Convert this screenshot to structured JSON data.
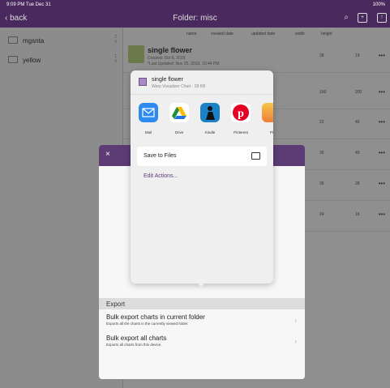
{
  "status": {
    "time": "9:09 PM  Tue Dec 31",
    "battery": "100%"
  },
  "nav": {
    "back_label": "back",
    "title": "Folder: misc",
    "icons": [
      "search-icon",
      "new-folder-icon",
      "export-icon"
    ]
  },
  "sidebar": {
    "folders": [
      {
        "name": "mgsnta",
        "count_a": "2",
        "count_b": "0"
      },
      {
        "name": "yellow",
        "count_a": "1",
        "count_b": "0"
      }
    ]
  },
  "columns": [
    "name",
    "created date",
    "updated date",
    "width",
    "height"
  ],
  "charts": [
    {
      "name": "single flower",
      "created": "Created: Oct 6, 2019",
      "updated": "*Last Updated: Nov 25, 2019, 10:44 PM",
      "width": "28",
      "height": "19"
    },
    {
      "width": "100",
      "height": "200"
    },
    {
      "width": "22",
      "height": "46"
    },
    {
      "width": "36",
      "height": "49"
    },
    {
      "width": "36",
      "height": "28"
    },
    {
      "width": "24",
      "height": "16"
    }
  ],
  "modal": {
    "close_label": "×",
    "section_label": "Export",
    "items": [
      {
        "title": "Bulk export charts in current folder",
        "desc": "Exports all the charts in the currently viewed folder."
      },
      {
        "title": "Bulk export all charts",
        "desc": "Exports all charts from this device."
      }
    ]
  },
  "share": {
    "file_name": "single flower",
    "file_meta": "Warp Visualizer Chart · 28 KB",
    "apps": [
      {
        "label": "Mail",
        "color": "#2d8bf0",
        "icon": "mail-icon"
      },
      {
        "label": "Drive",
        "color": "#ffffff",
        "icon": "drive-icon"
      },
      {
        "label": "Kindle",
        "color": "#1c82c6",
        "icon": "kindle-icon"
      },
      {
        "label": "Pinterest",
        "color": "#ffffff",
        "icon": "pinterest-icon"
      },
      {
        "label": "Pi",
        "color": "#f3a43b",
        "icon": "partial-app-icon"
      }
    ],
    "save_label": "Save to Files",
    "edit_actions_label": "Edit Actions..."
  }
}
